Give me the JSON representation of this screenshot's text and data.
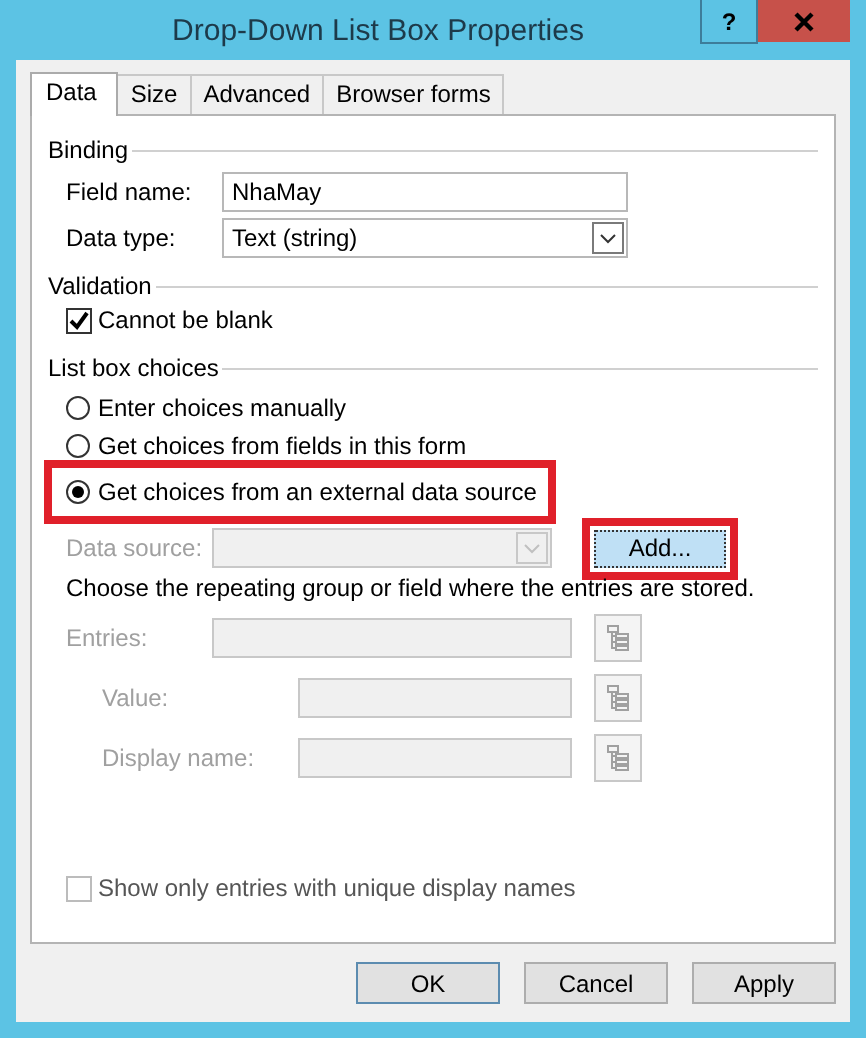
{
  "window": {
    "title": "Drop-Down List Box Properties",
    "help": "?"
  },
  "tabs": [
    {
      "label": "Data",
      "selected": true
    },
    {
      "label": "Size",
      "selected": false
    },
    {
      "label": "Advanced",
      "selected": false
    },
    {
      "label": "Browser forms",
      "selected": false
    }
  ],
  "binding": {
    "heading": "Binding",
    "field_name": {
      "label": "Field name:",
      "value": "NhaMay"
    },
    "data_type": {
      "label": "Data type:",
      "value": "Text (string)"
    }
  },
  "validation": {
    "heading": "Validation",
    "checkbox": {
      "label": "Cannot be blank",
      "checked": true
    }
  },
  "list_box_choices": {
    "heading": "List box choices",
    "options": [
      {
        "label": "Enter choices manually",
        "selected": false,
        "highlighted": false
      },
      {
        "label": "Get choices from fields in this form",
        "selected": false,
        "highlighted": false
      },
      {
        "label": "Get choices from an external data source",
        "selected": true,
        "highlighted": true
      }
    ],
    "data_source": {
      "label": "Data source:",
      "disabled": true
    },
    "add_button": {
      "label": "Add...",
      "highlighted": true
    },
    "instruction": "Choose the repeating group or field where the entries are stored.",
    "entries": {
      "label": "Entries:",
      "disabled": true,
      "children": [
        {
          "label": "Value:",
          "disabled": true
        },
        {
          "label": "Display name:",
          "disabled": true
        }
      ]
    },
    "unique_checkbox": {
      "label": "Show only entries with unique display names",
      "checked": false,
      "disabled": true
    }
  },
  "buttons": [
    {
      "label": "OK",
      "default": true
    },
    {
      "label": "Cancel",
      "default": false
    },
    {
      "label": "Apply",
      "default": false
    }
  ]
}
